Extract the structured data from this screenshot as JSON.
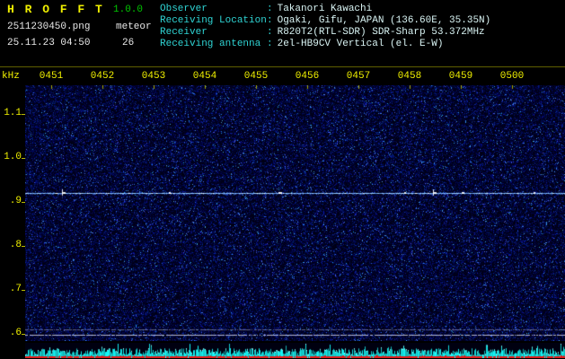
{
  "header": {
    "title": "H R O F F T",
    "version": "1.0.0",
    "filename": "2511230450.png",
    "mode": "meteor",
    "datetime": "25.11.23 04:50",
    "count": "26"
  },
  "station": {
    "separator": ":",
    "rows": [
      {
        "label": "Observer",
        "value": "Takanori Kawachi"
      },
      {
        "label": "Receiving Location",
        "value": "Ogaki, Gifu, JAPAN (136.60E, 35.35N)"
      },
      {
        "label": "Receiver",
        "value": "R820T2(RTL-SDR) SDR-Sharp 53.372MHz"
      },
      {
        "label": "Receiving antenna",
        "value": "2el-HB9CV Vertical (el. E-W)"
      }
    ]
  },
  "axes": {
    "ylabel": "kHz",
    "time_ticks": [
      "0451",
      "0452",
      "0453",
      "0454",
      "0455",
      "0456",
      "0457",
      "0458",
      "0459",
      "0500"
    ],
    "freq_ticks": [
      "1.1",
      "1.0",
      ".9",
      ".8",
      ".7",
      ".6"
    ]
  },
  "chart_data": {
    "type": "heatmap",
    "ylabel": "kHz",
    "x_tick_labels": [
      "0451",
      "0452",
      "0453",
      "0454",
      "0455",
      "0456",
      "0457",
      "0458",
      "0459",
      "0500"
    ],
    "y_tick_labels": [
      "1.1",
      "1.0",
      ".9",
      ".8",
      ".7",
      ".6"
    ],
    "y_tick_values_khz": [
      1.1,
      1.0,
      0.9,
      0.8,
      0.7,
      0.6
    ],
    "y_range_khz": [
      0.58,
      1.17
    ],
    "background": "dark blue random radio-noise speckle",
    "features": [
      {
        "type": "horizontal_line",
        "freq_khz": 0.92,
        "description": "bright continuous carrier/direct-signal line"
      },
      {
        "type": "horizontal_line",
        "freq_khz": 0.61,
        "description": "faint pale line near bottom"
      },
      {
        "type": "horizontal_line",
        "freq_khz": 0.6,
        "description": "faint pale line near bottom"
      }
    ],
    "bottom_strip": {
      "description": "broadband signal-level trace",
      "colors": [
        "cyan noise bars",
        "red baseline"
      ]
    },
    "meteor_echo_count": 26,
    "grid": "off",
    "legend": "none"
  },
  "colors": {
    "yellow": "#f0f000",
    "tick_yellow": "#a8a800",
    "green": "#00c800",
    "cyan_label": "#2fd4d4",
    "cyan_value": "#d9f4f4",
    "white": "#e8e8e8",
    "signal_line": "#a8c8ff",
    "strip_red": "#e01818",
    "strip_cyan": "#00e0e0",
    "noise_base": "#000018"
  }
}
